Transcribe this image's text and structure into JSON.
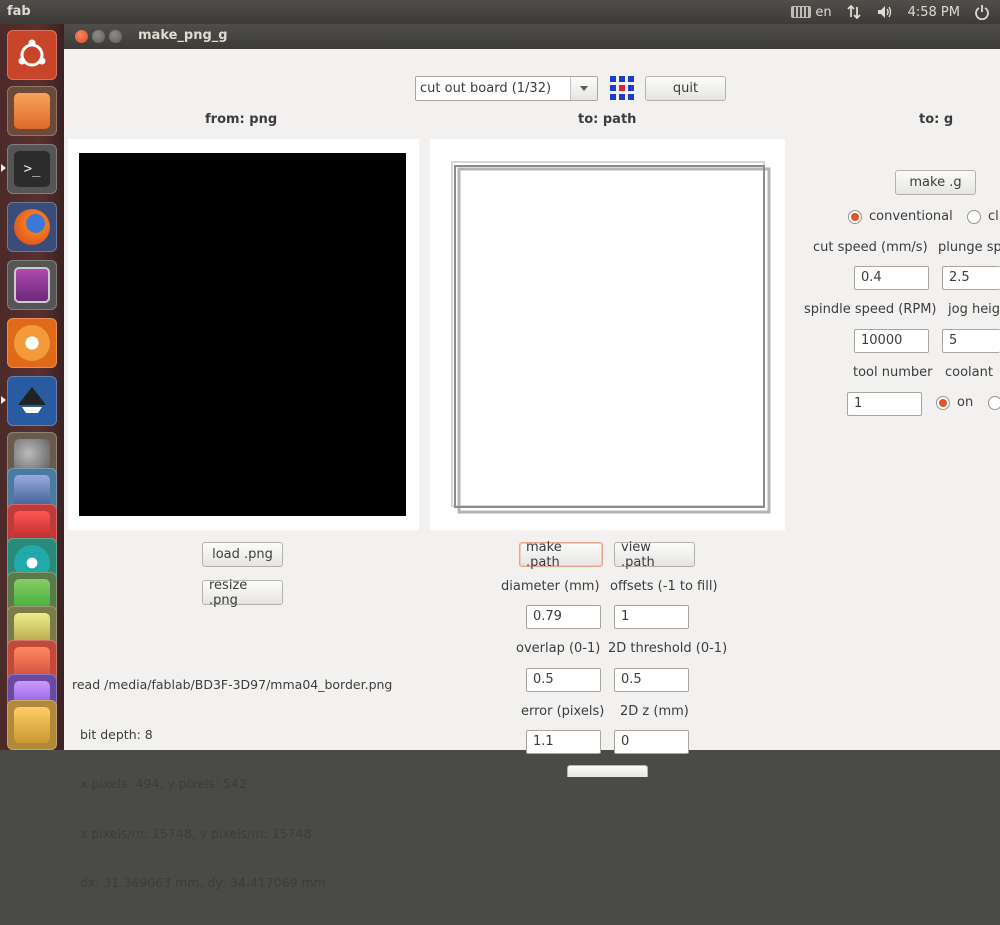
{
  "panel": {
    "app_name": "fab",
    "keyboard_layout": "en",
    "time": "4:58 PM",
    "icons": [
      "keyboard-icon",
      "network-icon",
      "volume-icon",
      "power-icon"
    ]
  },
  "launcher": {
    "items": [
      "ubuntu-dash",
      "files",
      "terminal",
      "firefox",
      "system-settings",
      "rhythmbox",
      "inkscape",
      "gimp",
      "app-7",
      "app-8",
      "app-9",
      "app-10",
      "app-11",
      "app-12",
      "app-13",
      "app-14"
    ]
  },
  "window": {
    "title": "make_png_g"
  },
  "toolbar": {
    "mode_selected": "cut out board (1/32)",
    "quit_label": "quit"
  },
  "columns": {
    "from_header": "from: png",
    "path_header": "to: path",
    "g_header": "to: g"
  },
  "png_panel": {
    "load_label": "load .png",
    "resize_label": "resize .png",
    "status_lines": [
      "read /media/fablab/BD3F-3D97/mma04_border.png",
      "  bit depth: 8",
      "  x pixels: 494, y pixels: 542",
      "  x pixels/m: 15748, y pixels/m: 15748",
      "  dx: 31.369063 mm, dy: 34.417069 mm"
    ]
  },
  "path_panel": {
    "make_path_label": "make .path",
    "view_path_label": "view .path",
    "diameter_label": "diameter (mm)",
    "diameter_value": "0.79",
    "offsets_label": "offsets (-1 to fill)",
    "offsets_value": "1",
    "overlap_label": "overlap (0-1)",
    "overlap_value": "0.5",
    "threshold_label": "2D threshold (0-1)",
    "threshold_value": "0.5",
    "error_label": "error (pixels)",
    "error_value": "1.1",
    "z_label": "2D z (mm)",
    "z_value": "0"
  },
  "g_panel": {
    "make_g_label": "make .g",
    "conventional_label": "conventional",
    "climb_label_partial": "cl",
    "cut_speed_label": "cut speed (mm/s)",
    "cut_speed_value": "0.4",
    "plunge_label_partial": "plunge sp",
    "plunge_value": "2.5",
    "spindle_label": "spindle speed (RPM)",
    "spindle_value": "10000",
    "jog_label_partial": "jog heig",
    "jog_value": "5",
    "tool_label": "tool number",
    "tool_value": "1",
    "coolant_label": "coolant",
    "coolant_on_label": "on"
  },
  "colors": {
    "accent_orange": "#e2542a",
    "window_bg": "#f2f1f0",
    "panel_bg": "#3c3b37"
  }
}
